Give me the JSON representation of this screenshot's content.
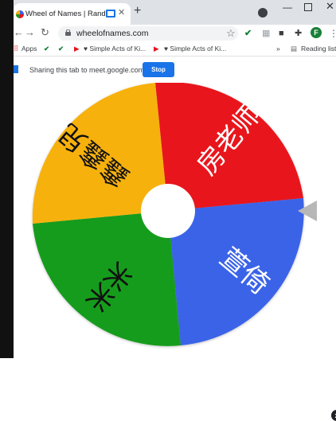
{
  "browser": {
    "tab_title": "Wheel of Names | Random",
    "new_tab": "+",
    "url": "wheelofnames.com",
    "profile_initial": "F"
  },
  "bookmarks": {
    "apps": "Apps",
    "item1": "♥ Simple Acts of Ki...",
    "item2": "♥ Simple Acts of Ki...",
    "overflow": "»",
    "reading_list": "Reading list"
  },
  "share_bar": {
    "message": "Sharing this tab to meet.google.com",
    "stop_label": "Stop"
  },
  "wheel": {
    "segments": [
      {
        "label": "房老师",
        "color": "#e8131d"
      },
      {
        "label": "萱倚",
        "color": "#3a63e8"
      },
      {
        "label": "米米",
        "color": "#149c1f"
      },
      {
        "label": "鑫鑫兒",
        "color": "#f7b10a"
      }
    ],
    "close_label": "x"
  },
  "colors": {
    "accent": "#1a73e8",
    "pointer": "#b7b7b7"
  }
}
